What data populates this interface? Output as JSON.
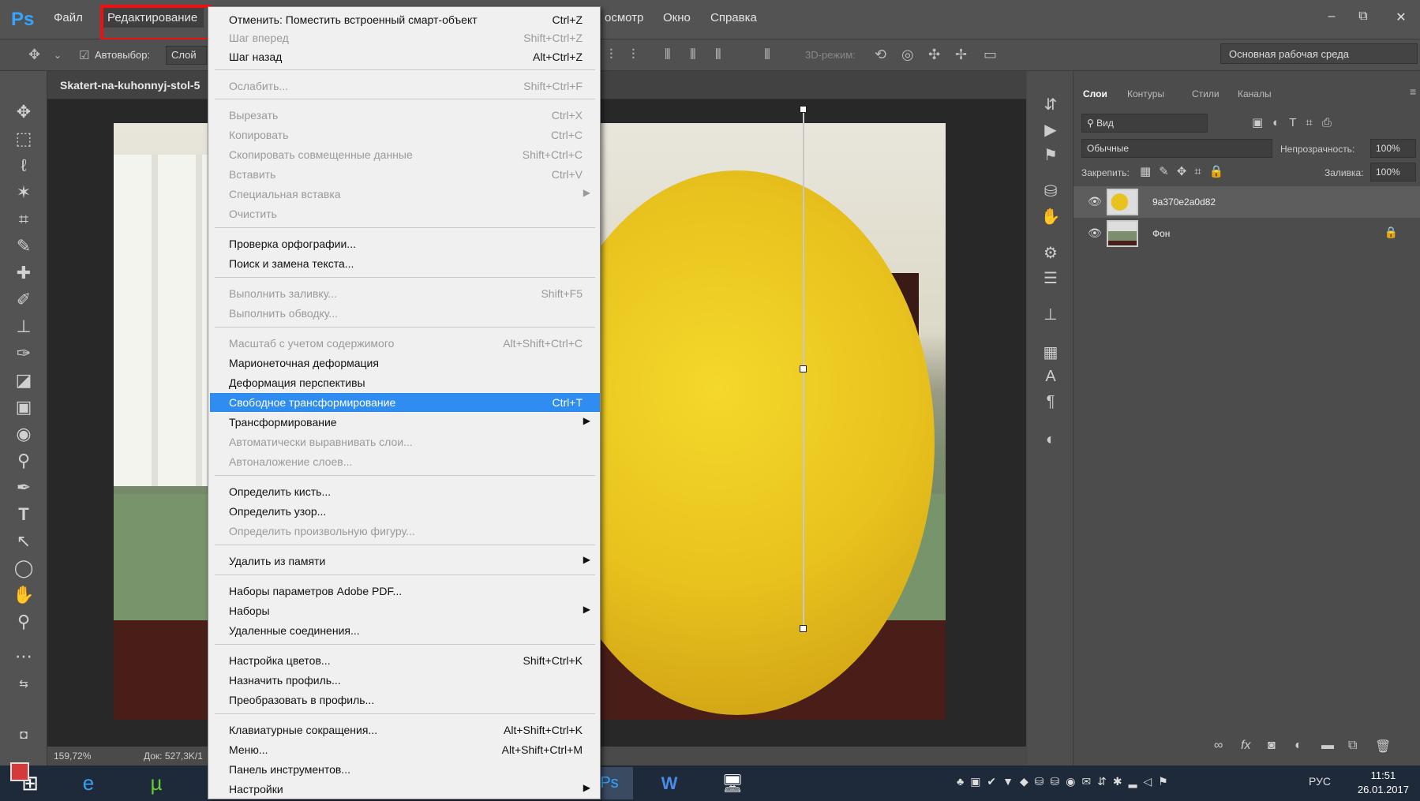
{
  "app": {
    "logo": "Ps",
    "menu": [
      "Файл",
      "Редактирование",
      "осмотр",
      "Окно",
      "Справка"
    ],
    "window_controls": [
      "–",
      "⧉",
      "✕"
    ]
  },
  "options_bar": {
    "autoselect_label": "Автовыбор:",
    "autoselect_value": "Слой",
    "mode_3d": "3D-режим:",
    "workspace": "Основная рабочая среда"
  },
  "document": {
    "tab_title": "Skatert-na-kuhonnyj-stol-5",
    "zoom": "159,72%",
    "doc_info": "Док: 527,3K/1"
  },
  "edit_menu": {
    "items": [
      {
        "label": "Отменить: Поместить встроенный смарт-объект",
        "shortcut": "Ctrl+Z",
        "state": "enabled"
      },
      {
        "label": "Шаг вперед",
        "shortcut": "Shift+Ctrl+Z",
        "state": "disabled"
      },
      {
        "label": "Шаг назад",
        "shortcut": "Alt+Ctrl+Z",
        "state": "enabled"
      },
      {
        "label": "Ослабить...",
        "shortcut": "Shift+Ctrl+F",
        "state": "disabled"
      },
      {
        "label": "Вырезать",
        "shortcut": "Ctrl+X",
        "state": "disabled"
      },
      {
        "label": "Копировать",
        "shortcut": "Ctrl+C",
        "state": "disabled"
      },
      {
        "label": "Скопировать совмещенные данные",
        "shortcut": "Shift+Ctrl+C",
        "state": "disabled"
      },
      {
        "label": "Вставить",
        "shortcut": "Ctrl+V",
        "state": "disabled"
      },
      {
        "label": "Специальная вставка",
        "shortcut": "",
        "state": "disabled",
        "submenu": true
      },
      {
        "label": "Очистить",
        "shortcut": "",
        "state": "disabled"
      },
      {
        "label": "Проверка орфографии...",
        "shortcut": "",
        "state": "enabled"
      },
      {
        "label": "Поиск и замена текста...",
        "shortcut": "",
        "state": "enabled"
      },
      {
        "label": "Выполнить заливку...",
        "shortcut": "Shift+F5",
        "state": "disabled"
      },
      {
        "label": "Выполнить обводку...",
        "shortcut": "",
        "state": "disabled"
      },
      {
        "label": "Масштаб с учетом содержимого",
        "shortcut": "Alt+Shift+Ctrl+C",
        "state": "disabled"
      },
      {
        "label": "Марионеточная деформация",
        "shortcut": "",
        "state": "enabled"
      },
      {
        "label": "Деформация перспективы",
        "shortcut": "",
        "state": "enabled"
      },
      {
        "label": "Свободное трансформирование",
        "shortcut": "Ctrl+T",
        "state": "highlighted"
      },
      {
        "label": "Трансформирование",
        "shortcut": "",
        "state": "enabled",
        "submenu": true
      },
      {
        "label": "Автоматически выравнивать слои...",
        "shortcut": "",
        "state": "disabled"
      },
      {
        "label": "Автоналожение слоев...",
        "shortcut": "",
        "state": "disabled"
      },
      {
        "label": "Определить кисть...",
        "shortcut": "",
        "state": "enabled"
      },
      {
        "label": "Определить узор...",
        "shortcut": "",
        "state": "enabled"
      },
      {
        "label": "Определить произвольную фигуру...",
        "shortcut": "",
        "state": "disabled"
      },
      {
        "label": "Удалить из памяти",
        "shortcut": "",
        "state": "enabled",
        "submenu": true
      },
      {
        "label": "Наборы параметров Adobe PDF...",
        "shortcut": "",
        "state": "enabled"
      },
      {
        "label": "Наборы",
        "shortcut": "",
        "state": "enabled",
        "submenu": true
      },
      {
        "label": "Удаленные соединения...",
        "shortcut": "",
        "state": "enabled"
      },
      {
        "label": "Настройка цветов...",
        "shortcut": "Shift+Ctrl+K",
        "state": "enabled"
      },
      {
        "label": "Назначить профиль...",
        "shortcut": "",
        "state": "enabled"
      },
      {
        "label": "Преобразовать в профиль...",
        "shortcut": "",
        "state": "enabled"
      },
      {
        "label": "Клавиатурные сокращения...",
        "shortcut": "Alt+Shift+Ctrl+K",
        "state": "enabled"
      },
      {
        "label": "Меню...",
        "shortcut": "Alt+Shift+Ctrl+M",
        "state": "enabled"
      },
      {
        "label": "Панель инструментов...",
        "shortcut": "",
        "state": "enabled"
      },
      {
        "label": "Настройки",
        "shortcut": "",
        "state": "enabled",
        "submenu": true
      }
    ]
  },
  "layers_panel": {
    "tabs": [
      "Слои",
      "Контуры",
      "Стили",
      "Каналы"
    ],
    "filter_label": "Вид",
    "blend_mode": "Обычные",
    "opacity_label": "Непрозрачность:",
    "opacity_value": "100%",
    "lock_label": "Закрепить:",
    "fill_label": "Заливка:",
    "fill_value": "100%",
    "layers": [
      {
        "name": "9a370e2a0d82",
        "selected": true,
        "locked": false
      },
      {
        "name": "Фон",
        "selected": false,
        "locked": true
      }
    ]
  },
  "taskbar": {
    "language": "РУС",
    "time": "11:51",
    "date": "26.01.2017"
  },
  "colors": {
    "accent": "#2f8cf0",
    "foreground_swatch": "#d43a3a",
    "highlight_box": "#ee1010"
  }
}
